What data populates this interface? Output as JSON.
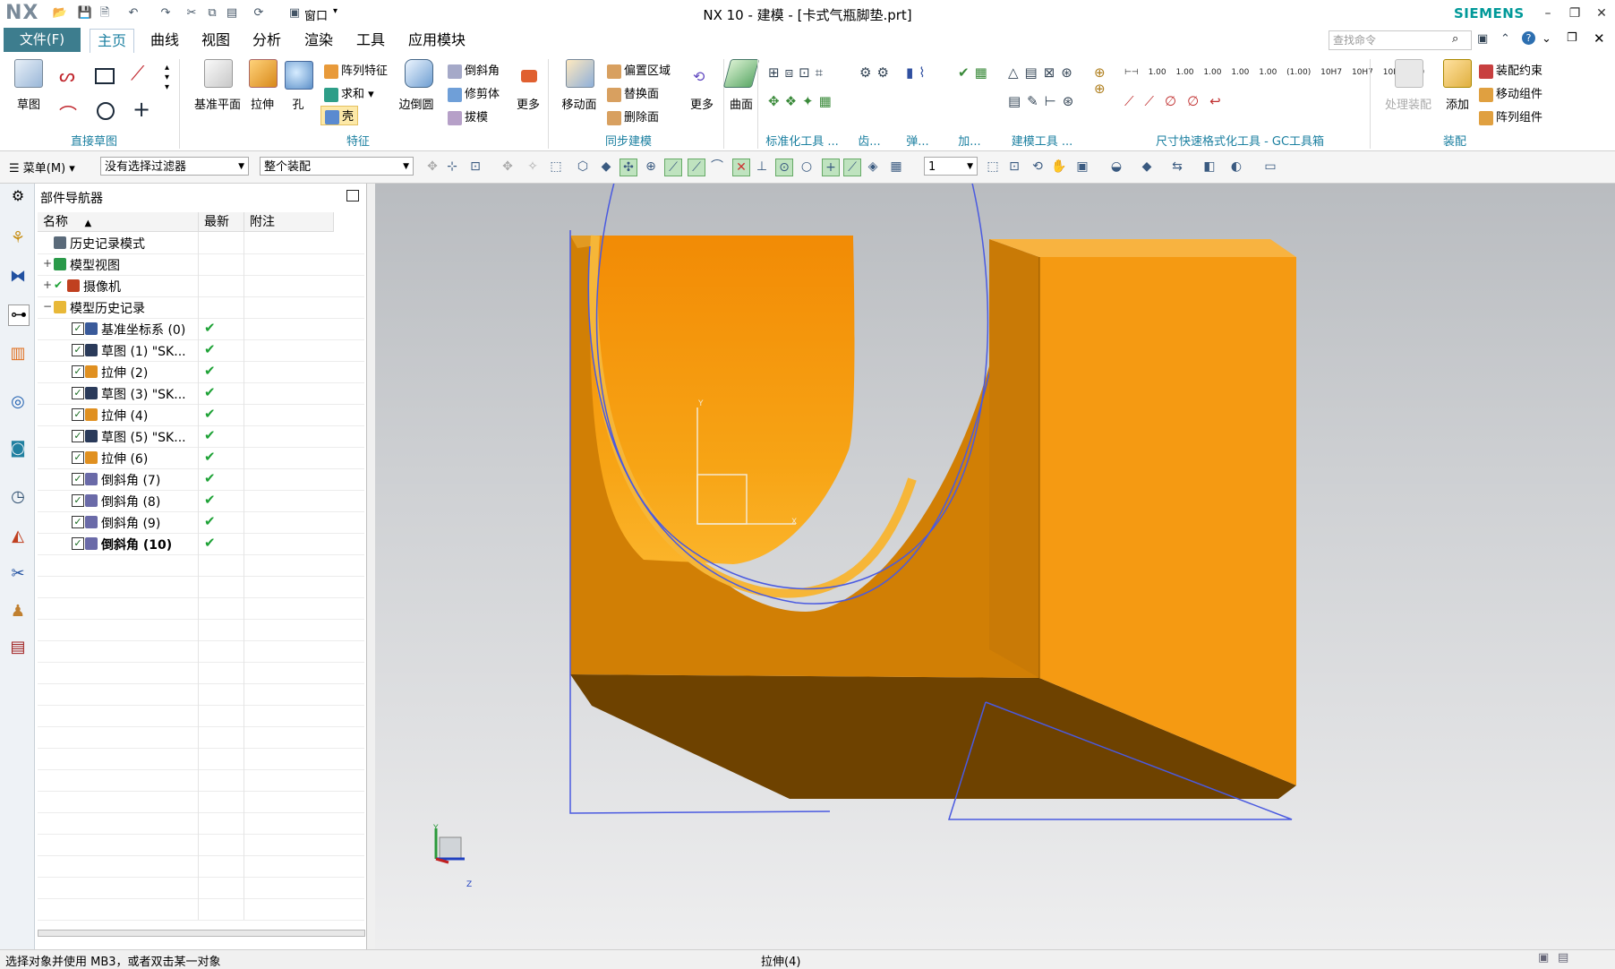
{
  "titlebar": {
    "logo": "NX",
    "window_title": "NX 10 - 建模 - [卡式气瓶脚垫.prt]",
    "window_menu": "窗口",
    "brand": "SIEMENS"
  },
  "menu": {
    "file": "文件(F)",
    "tabs": [
      "主页",
      "曲线",
      "视图",
      "分析",
      "渲染",
      "工具",
      "应用模块"
    ],
    "active_tab": "主页",
    "search_placeholder": "查找命令"
  },
  "ribbon": {
    "direct_sketch": {
      "sketch": "草图",
      "group": "直接草图"
    },
    "feature": {
      "datum_plane": "基准平面",
      "extrude": "拉伸",
      "hole": "孔",
      "pattern": "阵列特征",
      "unite": "求和",
      "shell": "壳",
      "edge_blend": "边倒圆",
      "chamfer": "倒斜角",
      "trim_body": "修剪体",
      "draft": "拔模",
      "more": "更多",
      "group": "特征"
    },
    "sync": {
      "move_face": "移动面",
      "offset_region": "偏置区域",
      "replace_face": "替换面",
      "delete_face": "删除面",
      "more": "更多",
      "group": "同步建模"
    },
    "surface": {
      "label": "曲面"
    },
    "group_labels": [
      "标准化工具 ...",
      "齿...",
      "弹...",
      "加...",
      "建模工具 ...",
      "尺寸快速格式化工具 - GC工具箱",
      "装配"
    ],
    "assembly": {
      "process": "处理装配",
      "add": "添加",
      "constraint": "装配约束",
      "move_component": "移动组件",
      "pattern_component": "阵列组件"
    },
    "dim_labels": [
      "1.00",
      "1.00",
      "1.00",
      "1.00",
      "1.00",
      "(1.00)",
      "10H7",
      "10H7",
      "10H7",
      "10"
    ]
  },
  "selbar": {
    "menu": "菜单(M)",
    "filter": "没有选择过滤器",
    "scope": "整个装配",
    "layer": "1"
  },
  "navigator": {
    "title": "部件导航器",
    "columns": [
      "名称",
      "最新",
      "附注"
    ],
    "rows": [
      {
        "label": "历史记录模式",
        "level": 0,
        "icon": "clock-icon",
        "expander": "",
        "check": "",
        "ok": false,
        "bold": false
      },
      {
        "label": "模型视图",
        "level": 0,
        "icon": "model-views-icon",
        "expander": "+",
        "check": "",
        "ok": false,
        "bold": false
      },
      {
        "label": "摄像机",
        "level": 0,
        "icon": "camera-icon",
        "expander": "+",
        "check": "✔",
        "ok": false,
        "bold": false
      },
      {
        "label": "模型历史记录",
        "level": 0,
        "icon": "folder-icon",
        "expander": "−",
        "check": "",
        "ok": false,
        "bold": false
      },
      {
        "label": "基准坐标系 (0)",
        "level": 1,
        "icon": "datum-csys-icon",
        "expander": "",
        "check": "✓",
        "ok": true,
        "bold": false
      },
      {
        "label": "草图 (1) \"SK...",
        "level": 1,
        "icon": "sketch-icon",
        "expander": "",
        "check": "✓",
        "ok": true,
        "bold": false
      },
      {
        "label": "拉伸 (2)",
        "level": 1,
        "icon": "extrude-icon",
        "expander": "",
        "check": "✓",
        "ok": true,
        "bold": false
      },
      {
        "label": "草图 (3) \"SK...",
        "level": 1,
        "icon": "sketch-icon",
        "expander": "",
        "check": "✓",
        "ok": true,
        "bold": false
      },
      {
        "label": "拉伸 (4)",
        "level": 1,
        "icon": "extrude-icon",
        "expander": "",
        "check": "✓",
        "ok": true,
        "bold": false
      },
      {
        "label": "草图 (5) \"SK...",
        "level": 1,
        "icon": "sketch-icon",
        "expander": "",
        "check": "✓",
        "ok": true,
        "bold": false
      },
      {
        "label": "拉伸 (6)",
        "level": 1,
        "icon": "extrude-icon",
        "expander": "",
        "check": "✓",
        "ok": true,
        "bold": false
      },
      {
        "label": "倒斜角 (7)",
        "level": 1,
        "icon": "chamfer-icon",
        "expander": "",
        "check": "✓",
        "ok": true,
        "bold": false
      },
      {
        "label": "倒斜角 (8)",
        "level": 1,
        "icon": "chamfer-icon",
        "expander": "",
        "check": "✓",
        "ok": true,
        "bold": false
      },
      {
        "label": "倒斜角 (9)",
        "level": 1,
        "icon": "chamfer-icon",
        "expander": "",
        "check": "✓",
        "ok": true,
        "bold": false
      },
      {
        "label": "倒斜角 (10)",
        "level": 1,
        "icon": "chamfer-icon",
        "expander": "",
        "check": "✓",
        "ok": true,
        "bold": true
      }
    ]
  },
  "viewport": {
    "triad_labels": {
      "y": "Y",
      "z": "Z"
    },
    "wcs_labels": {
      "y": "Y",
      "x": "X"
    }
  },
  "status": {
    "left": "选择对象并使用 MB3，或者双击某一对象",
    "center": "拉伸(4)"
  },
  "colors": {
    "accent": "#3d7d8e",
    "tab_active_text": "#1a7fa0",
    "brand": "#009999",
    "ok_green": "#1ea236",
    "part_light": "#f59a12",
    "part_mid": "#d27f08",
    "part_dark": "#6b3d00",
    "wire_blue": "#4a5ae0"
  }
}
